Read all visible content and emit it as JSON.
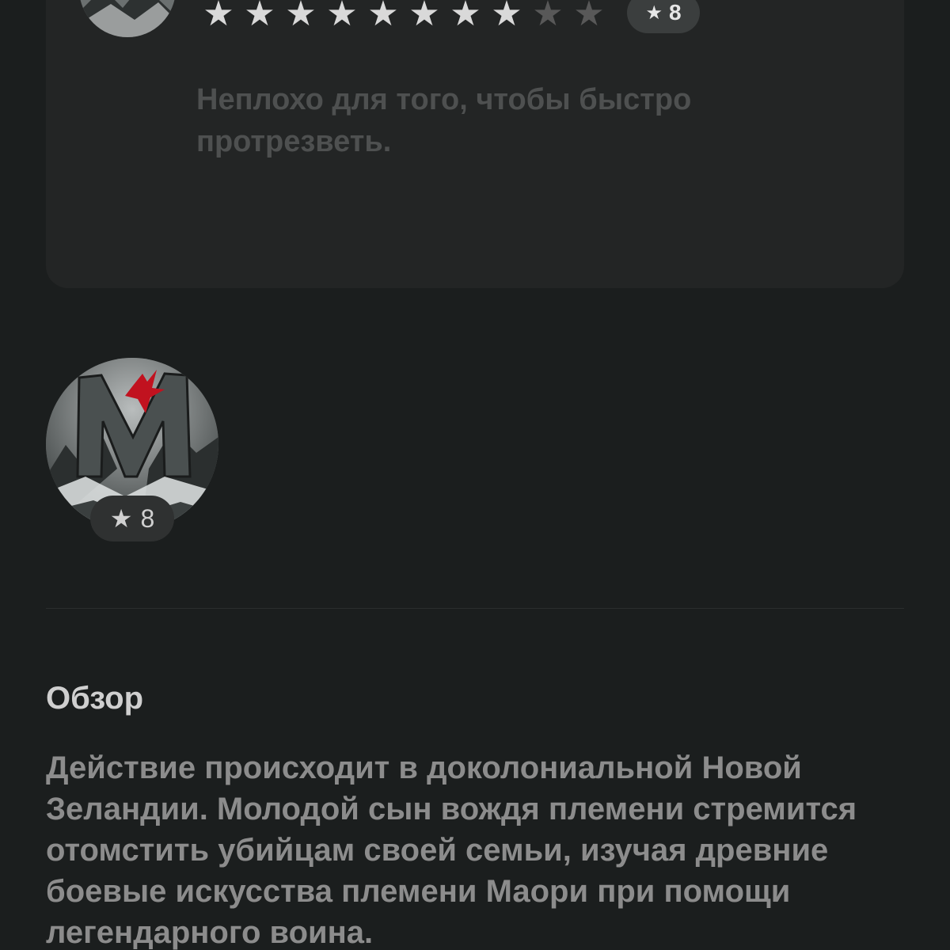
{
  "review": {
    "rating": 8,
    "max_rating": 10,
    "score_label": "8",
    "text": "Неплохо для того, чтобы быстро протрезветь."
  },
  "user": {
    "rating_label": "8"
  },
  "overview": {
    "title": "Обзор",
    "text": "Действие происходит в доколониальной Новой Зеландии. Молодой сын вождя племени стремится отомстить убийцам своей семьи, изучая древние боевые искусства племени Маори при помощи легендарного воина."
  },
  "colors": {
    "background": "#1b1e1e",
    "card": "#232525",
    "accent_red": "#c1121f"
  }
}
